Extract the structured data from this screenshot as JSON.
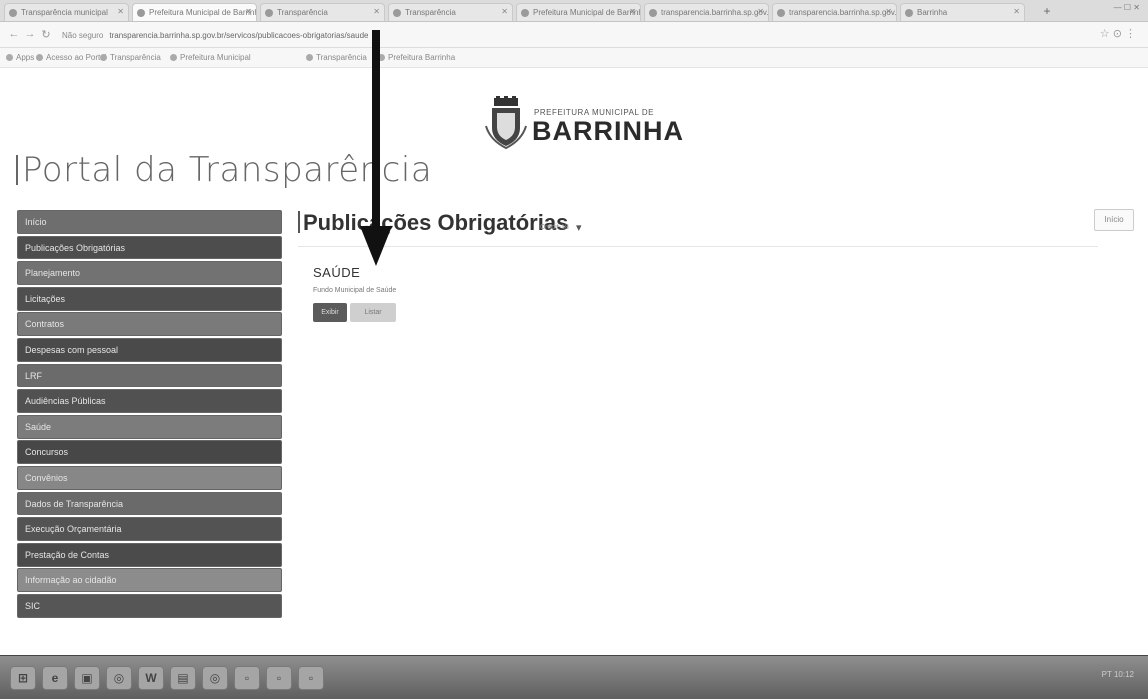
{
  "browser": {
    "tabs": [
      {
        "label": "Transparência municipal",
        "active": false
      },
      {
        "label": "Prefeitura Municipal de Barrinha",
        "active": true
      },
      {
        "label": "Transparência",
        "active": false
      },
      {
        "label": "Transparência",
        "active": false
      },
      {
        "label": "Prefeitura Municipal de Barrinha",
        "active": false
      },
      {
        "label": "transparencia.barrinha.sp.gov.br",
        "active": false
      },
      {
        "label": "transparencia.barrinha.sp.gov.br",
        "active": false
      },
      {
        "label": "Barrinha",
        "active": false
      }
    ],
    "new_tab": "+",
    "url_prefix": "Não seguro",
    "url": "transparencia.barrinha.sp.gov.br/servicos/publicacoes-obrigatorias/saude",
    "bookmarks": [
      "Apps",
      "Acesso ao Portal",
      "Transparência",
      "Prefeitura Municipal",
      "Transparência",
      "Prefeitura Barrinha"
    ]
  },
  "page": {
    "logo_subtitle": "PREFEITURA MUNICIPAL DE",
    "logo_name": "BARRINHA",
    "portal_title": "Portal da Transparência",
    "sidebar": [
      {
        "label": "Início",
        "color": "#6e6e6e"
      },
      {
        "label": "Publicações Obrigatórias",
        "color": "#4d4d4d"
      },
      {
        "label": "Planejamento",
        "color": "#727272"
      },
      {
        "label": "Licitações",
        "color": "#4f4f4f"
      },
      {
        "label": "Contratos",
        "color": "#7a7a7a"
      },
      {
        "label": "Despesas com pessoal",
        "color": "#4a4a4a"
      },
      {
        "label": "LRF",
        "color": "#6b6b6b"
      },
      {
        "label": "Audiências Públicas",
        "color": "#515151"
      },
      {
        "label": "Saúde",
        "color": "#7c7c7c"
      },
      {
        "label": "Concursos",
        "color": "#474747"
      },
      {
        "label": "Convênios",
        "color": "#878787"
      },
      {
        "label": "Dados de Transparência",
        "color": "#6a6a6a"
      },
      {
        "label": "Execução Orçamentária",
        "color": "#535353"
      },
      {
        "label": "Prestação de Contas",
        "color": "#4b4b4b"
      },
      {
        "label": "Informação ao cidadão",
        "color": "#8c8c8c"
      },
      {
        "label": "SIC",
        "color": "#565656"
      }
    ],
    "section_title": "Publicações Obrigatórias",
    "section_small": "Credit-18",
    "top_button": "Início",
    "item_title": "SAÚDE",
    "item_subtitle": "Fundo Municipal de Saúde",
    "btn_primary": "Exibir",
    "btn_secondary": "Listar"
  },
  "taskbar": {
    "icons": [
      "start-icon",
      "ie-icon",
      "explorer-icon",
      "chrome-icon",
      "word-icon",
      "folder-icon",
      "chrome-icon",
      "app-icon",
      "app-icon",
      "app-icon"
    ],
    "tray": "PT 10:12"
  }
}
